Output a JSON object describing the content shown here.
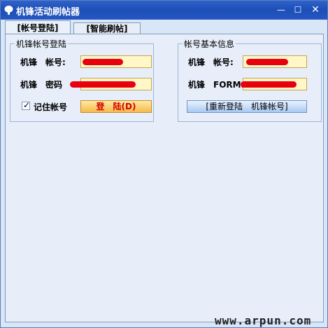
{
  "window": {
    "title": "机锋活动刷帖器",
    "minimize_glyph": "—",
    "maximize_glyph": "☐",
    "close_glyph": "✕"
  },
  "tabs": [
    {
      "label": "[帐号登陆]",
      "active": true
    },
    {
      "label": "[智能刷帖]",
      "active": false
    }
  ],
  "login_group": {
    "legend": "机锋帐号登陆",
    "account_label": "机锋　帐号:",
    "password_label": "机锋　密码",
    "account_value": "",
    "password_value": "",
    "remember_label": "记住帐号",
    "remember_checked": true,
    "login_button": "登　陆(D)"
  },
  "info_group": {
    "legend": "帐号基本信息",
    "account_label": "机锋　帐号:",
    "form_label": "机锋　FORM:",
    "relogin_button": "[重新登陆　机锋帐号]"
  },
  "watermark": "www.arpun.com",
  "colors": {
    "titlebar": "#1d4fb7",
    "window_bg": "#d9e6f7",
    "field_bg": "#fff7c8",
    "redaction": "#e8000f"
  }
}
